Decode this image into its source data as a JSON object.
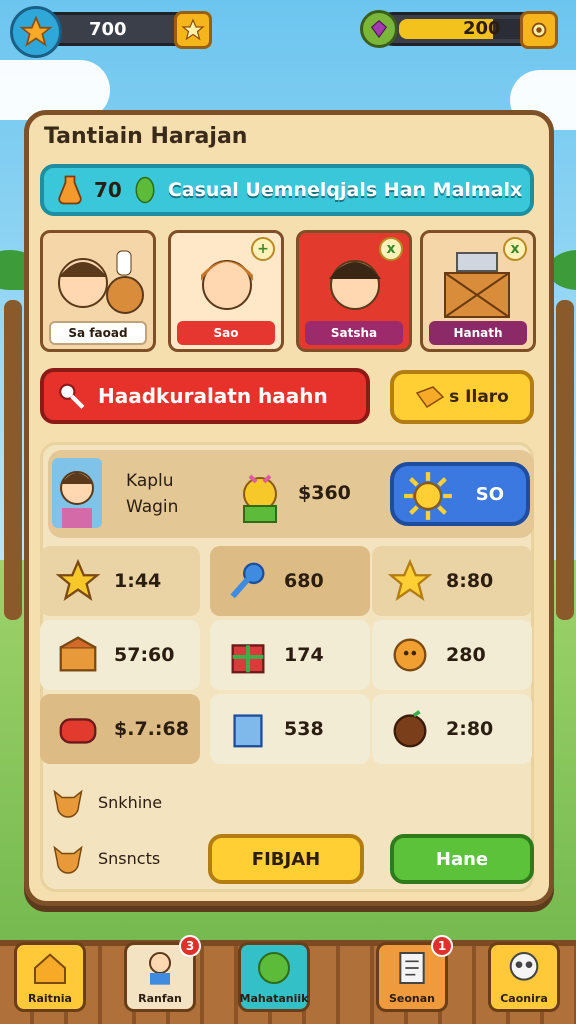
{
  "hud": {
    "stars": "700",
    "gems": "200",
    "gem_bar_fill": 0.7
  },
  "panel": {
    "title": "Tantiain Harajan",
    "banner": {
      "count": "70",
      "text": "Casual Uemnelqjals Han Malmalx"
    },
    "characters": [
      {
        "label": "Sa faoad",
        "color": "#ffffff",
        "text_color": "#2b1d10"
      },
      {
        "label": "Sao",
        "color": "#e5362f",
        "text_color": "#ffffff",
        "badge": "+"
      },
      {
        "label": "Satsha",
        "color": "#9d2a6a",
        "text_color": "#ffffff",
        "badge": "x"
      },
      {
        "label": "Hanath",
        "color": "#8b2a66",
        "text_color": "#ffffff",
        "badge": "x"
      }
    ],
    "search_bar": "Haadkuralatn haahn",
    "offer_button": "s Ilaro",
    "featured": {
      "name_line1": "Kaplu",
      "name_line2": "Wagin",
      "price": "$360",
      "buy": "SO"
    },
    "items": [
      {
        "icon": "star-fruit-icon",
        "value": "1:44",
        "bg": "#ead3a4"
      },
      {
        "icon": "blue-key-icon",
        "value": "680",
        "bg": "#dcbb84"
      },
      {
        "icon": "gold-star-icon",
        "value": "8:80",
        "bg": "#ead3a4"
      },
      {
        "icon": "treasure-chest-icon",
        "value": "57:60",
        "bg": "#f2ecd4"
      },
      {
        "icon": "gift-box-icon",
        "value": "174",
        "bg": "#f2ecd4"
      },
      {
        "icon": "sun-cookie-icon",
        "value": "280",
        "bg": "#f2ecd4"
      },
      {
        "icon": "red-barrel-icon",
        "value": "$.7.:68",
        "bg": "#dcbb84"
      },
      {
        "icon": "blue-crate-icon",
        "value": "538",
        "bg": "#f2ecd4"
      },
      {
        "icon": "coconut-icon",
        "value": "2:80",
        "bg": "#f2ecd4"
      }
    ],
    "pet_rows": [
      "Snkhine",
      "Snsncts"
    ],
    "primary_button": "FIBJAH",
    "secondary_button": "Hane"
  },
  "nav": [
    {
      "label": "Raitnia",
      "icon": "house-icon",
      "bg": "#ffc93a"
    },
    {
      "label": "Ranfan",
      "icon": "avatar-icon",
      "bg": "#f4e3c2",
      "badge": "3"
    },
    {
      "label": "Mahataniik",
      "icon": "leaf-ball-icon",
      "bg": "#33c0c7"
    },
    {
      "label": "Seonan",
      "icon": "notebook-icon",
      "bg": "#f09a3e",
      "badge": "1"
    },
    {
      "label": "Caonira",
      "icon": "skull-icon",
      "bg": "#ffc93a"
    }
  ]
}
